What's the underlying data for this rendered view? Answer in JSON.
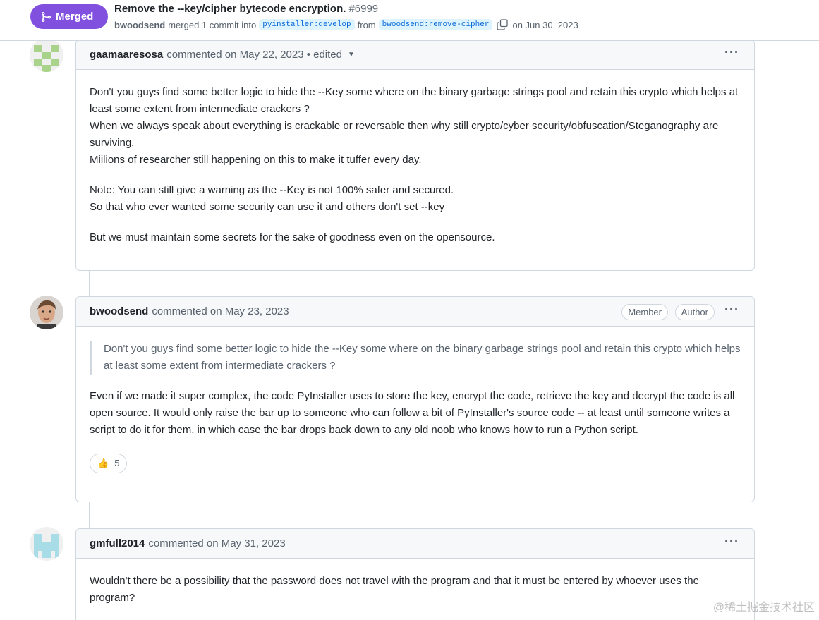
{
  "header": {
    "status": "Merged",
    "title": "Remove the --key/cipher bytecode encryption.",
    "number": "#6999",
    "author": "bwoodsend",
    "merged_text": "merged 1 commit into",
    "base_branch": "pyinstaller:develop",
    "from_text": "from",
    "head_branch": "bwoodsend:remove-cipher",
    "date_text": "on Jun 30, 2023"
  },
  "comments": [
    {
      "author": "gaamaaresosa",
      "meta": "commented on May 22, 2023 • edited",
      "paragraphs": [
        "Don't you guys find some better logic to hide the --Key some where on the binary garbage strings pool and retain this crypto which helps at least some extent from intermediate crackers ?\nWhen we always speak about everything is crackable or reversable then why still crypto/cyber security/obfuscation/Steganography are surviving.\nMiilions of researcher still happening on this to make it tuffer every day.",
        "Note: You can still give a warning as the --Key is not 100% safer and secured.\nSo that who ever wanted some security can use it and others don't set --key",
        "But we must maintain some secrets for the sake of goodness even on the opensource."
      ]
    },
    {
      "author": "bwoodsend",
      "meta": "commented on May 23, 2023",
      "badges": [
        "Member",
        "Author"
      ],
      "quote": "Don't you guys find some better logic to hide the --Key some where on the binary garbage strings pool and retain this crypto which helps at least some extent from intermediate crackers ?",
      "paragraphs": [
        "Even if we made it super complex, the code PyInstaller uses to store the key, encrypt the code, retrieve the key and decrypt the code is all open source. It would only raise the bar up to someone who can follow a bit of PyInstaller's source code -- at least until someone writes a script to do it for them, in which case the bar drops back down to any old noob who knows how to run a Python script."
      ],
      "reaction": {
        "emoji": "👍",
        "count": "5"
      }
    },
    {
      "author": "gmfull2014",
      "meta": "commented on May 31, 2023",
      "paragraphs": [
        "Wouldn't there be a possibility that the password does not travel with the program and that it must be entered by whoever uses the program?"
      ]
    }
  ],
  "more_label": "···",
  "watermark": "@稀土掘金技术社区",
  "colors": {
    "merged": "#8250df",
    "border": "#d0d7de",
    "branch_bg": "#ddf4ff"
  }
}
